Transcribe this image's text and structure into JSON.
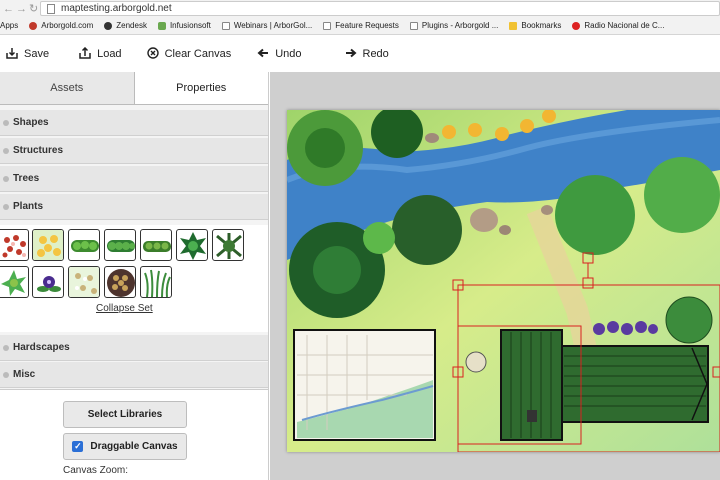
{
  "browser": {
    "url": "maptesting.arborgold.net",
    "bookmarks": [
      "Apps",
      "Arborgold.com",
      "Zendesk",
      "Infusionsoft",
      "Webinars | ArborGol...",
      "Feature Requests",
      "Plugins - Arborgold ...",
      "Bookmarks",
      "Radio Nacional de C..."
    ]
  },
  "toolbar": {
    "save": "Save",
    "load": "Load",
    "clear": "Clear Canvas",
    "undo": "Undo",
    "redo": "Redo"
  },
  "panel": {
    "tabs": [
      "Assets",
      "Properties"
    ],
    "sections": [
      "Shapes",
      "Structures",
      "Trees",
      "Plants",
      "Hardscapes",
      "Misc"
    ],
    "collapse_label": "Collapse Set",
    "select_libraries": "Select Libraries",
    "draggable_canvas": "Draggable Canvas",
    "canvas_zoom": "Canvas Zoom:"
  },
  "colors": {
    "accent_check": "#2b6fd6",
    "selection_outline": "#d92020"
  },
  "icons": {
    "save": "save-icon",
    "load": "upload-icon",
    "clear": "clear-circle-x-icon",
    "undo": "arrow-left-icon",
    "redo": "arrow-right-icon"
  }
}
